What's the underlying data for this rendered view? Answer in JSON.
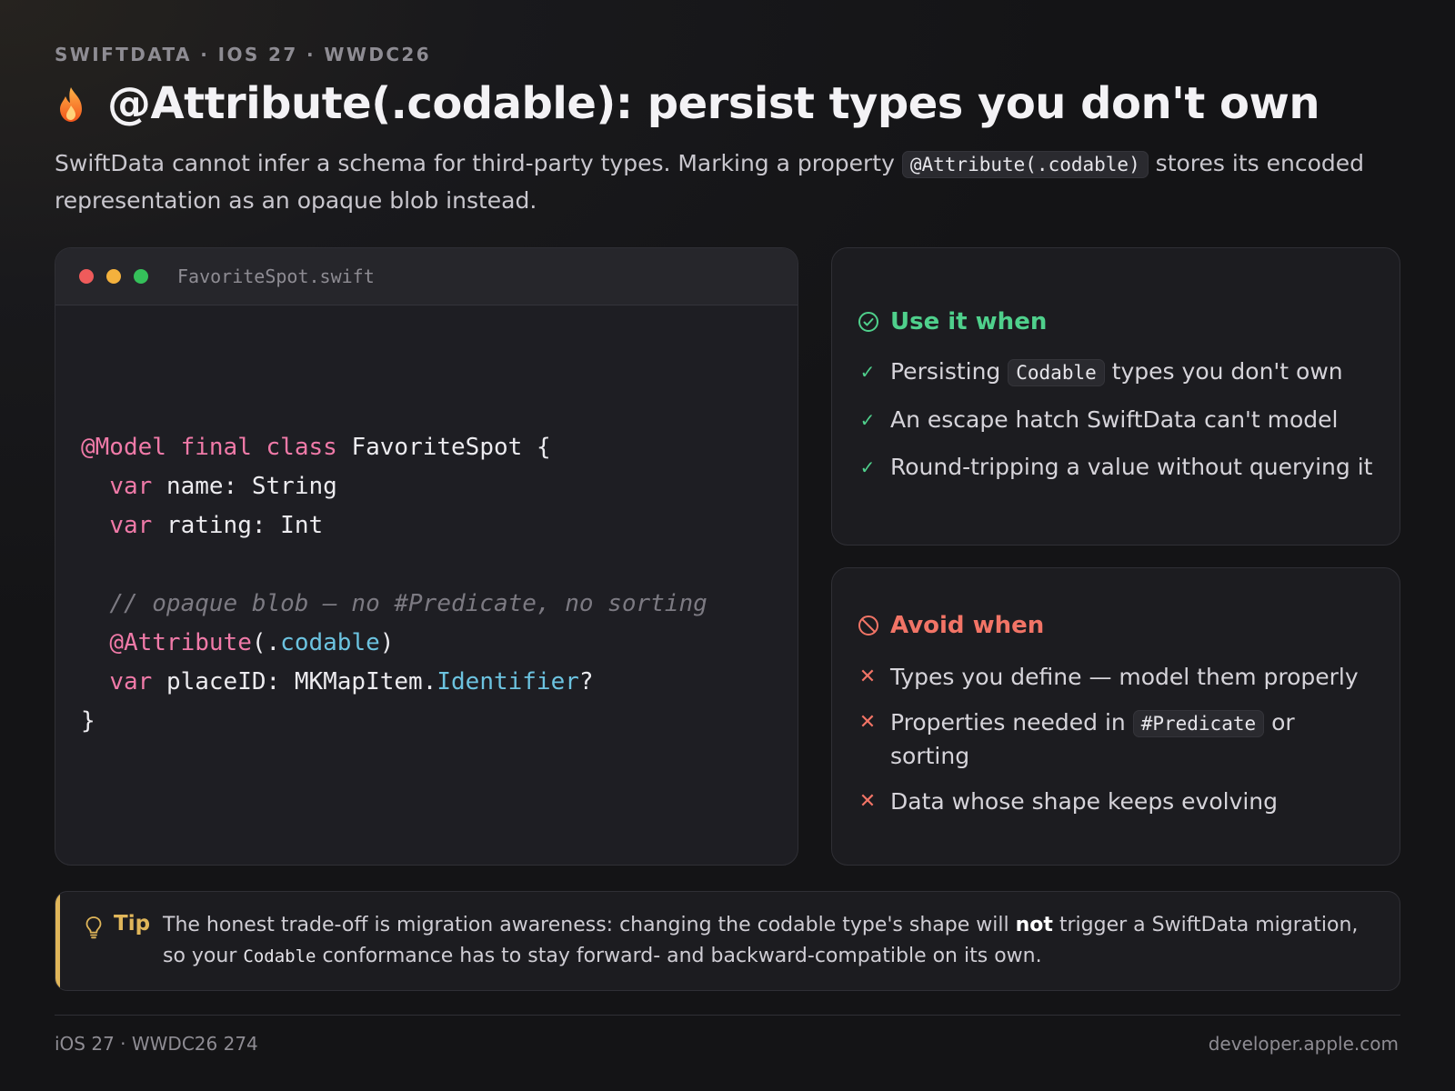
{
  "header": {
    "eyebrow": "SWIFTDATA · IOS 27 · WWDC26",
    "icon": "flame-icon",
    "title": "@Attribute(.codable): persist types you don't own",
    "lede_before": "SwiftData cannot infer a schema for third-party types. Marking a property ",
    "lede_code": "@Attribute(.codable)",
    "lede_after": " stores its encoded representation as an opaque blob instead."
  },
  "code_window": {
    "filename": "FavoriteSpot.swift",
    "traffic_lights": [
      "#ef5b5b",
      "#f4b13d",
      "#35c05a"
    ],
    "lines": {
      "l1_kw1": "@Model",
      "l1_kw2": "final",
      "l1_kw3": "class",
      "l1_rest": "FavoriteSpot {",
      "l2_kw": "var",
      "l2_rest": "name: String",
      "l3_kw": "var",
      "l3_rest": "rating: Int",
      "l5_comment": "// opaque blob — no #Predicate, no sorting",
      "l6_attr": "@Attribute",
      "l6_open": "(.",
      "l6_member": "codable",
      "l6_close": ")",
      "l7_kw": "var",
      "l7_rest": "placeID: MKMapItem.",
      "l7_member": "Identifier",
      "l7_end": "?",
      "l8": "}"
    }
  },
  "use_card": {
    "icon": "check-circle-icon",
    "heading": "Use it when",
    "item1_before": "Persisting ",
    "item1_code": "Codable",
    "item1_after": " types you don't own",
    "item2": "An escape hatch SwiftData can't model",
    "item3": "Round-tripping a value without querying it"
  },
  "avoid_card": {
    "icon": "prohibited-icon",
    "heading": "Avoid when",
    "item1": "Types you define — model them properly",
    "item2_before": "Properties needed in ",
    "item2_code": "#Predicate",
    "item2_after": " or sorting",
    "item3": "Data whose shape keeps evolving"
  },
  "tip": {
    "icon": "lightbulb-icon",
    "label": "Tip",
    "text_before": "The honest trade-off is migration awareness: changing the codable type's shape will ",
    "text_bold": "not",
    "text_mid": " trigger a SwiftData migration, so your ",
    "text_code": "Codable",
    "text_after": " conformance has to stay forward- and backward-compatible on its own."
  },
  "footer": {
    "left": "iOS 27 · WWDC26 274",
    "right": "developer.apple.com"
  },
  "colors": {
    "accent_green": "#4fd08c",
    "accent_red": "#f27466",
    "accent_gold": "#e0b65a",
    "keyword_pink": "#f07aa8",
    "member_blue": "#6cc3e0"
  }
}
